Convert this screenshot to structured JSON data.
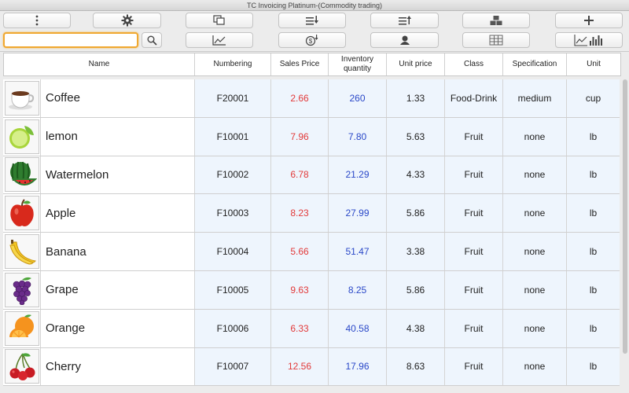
{
  "window": {
    "title": "TC Invoicing Platinum-(Commodity trading)"
  },
  "toolbar": {
    "row1": [
      {
        "name": "more-menu-button",
        "icon": "vertical-dots-icon"
      },
      {
        "name": "settings-button",
        "icon": "gear-icon"
      },
      {
        "name": "copy-button",
        "icon": "copy-pages-icon"
      },
      {
        "name": "import-button",
        "icon": "list-arrow-down-icon"
      },
      {
        "name": "export-button",
        "icon": "list-arrow-up-icon"
      },
      {
        "name": "stock-button",
        "icon": "boxes-stack-icon"
      },
      {
        "name": "add-button",
        "icon": "plus-icon"
      }
    ],
    "row2": [
      {
        "name": "trend-chart-button",
        "icon": "line-chart-icon"
      },
      {
        "name": "pricing-button",
        "icon": "coin-dollar-icon"
      },
      {
        "name": "customer-button",
        "icon": "person-icon"
      },
      {
        "name": "grid-view-button",
        "icon": "table-grid-icon"
      },
      {
        "name": "statistics-button",
        "icon": "chart-bars-icon"
      }
    ],
    "search": {
      "value": "",
      "placeholder": ""
    }
  },
  "table": {
    "columns": [
      "Name",
      "Numbering",
      "Sales Price",
      "Inventory quantity",
      "Unit price",
      "Class",
      "Specification",
      "Unit"
    ],
    "rows": [
      {
        "image": "coffee-cup-icon",
        "name": "Coffee",
        "numbering": "F20001",
        "sales_price": "2.66",
        "inventory": "260",
        "unit_price": "1.33",
        "class": "Food-Drink",
        "spec": "medium",
        "unit": "cup"
      },
      {
        "image": "lemon-icon",
        "name": "lemon",
        "numbering": "F10001",
        "sales_price": "7.96",
        "inventory": "7.80",
        "unit_price": "5.63",
        "class": "Fruit",
        "spec": "none",
        "unit": "lb"
      },
      {
        "image": "watermelon-icon",
        "name": "Watermelon",
        "numbering": "F10002",
        "sales_price": "6.78",
        "inventory": "21.29",
        "unit_price": "4.33",
        "class": "Fruit",
        "spec": "none",
        "unit": "lb"
      },
      {
        "image": "apple-icon",
        "name": "Apple",
        "numbering": "F10003",
        "sales_price": "8.23",
        "inventory": "27.99",
        "unit_price": "5.86",
        "class": "Fruit",
        "spec": "none",
        "unit": "lb"
      },
      {
        "image": "banana-icon",
        "name": "Banana",
        "numbering": "F10004",
        "sales_price": "5.66",
        "inventory": "51.47",
        "unit_price": "3.38",
        "class": "Fruit",
        "spec": "none",
        "unit": "lb"
      },
      {
        "image": "grape-icon",
        "name": "Grape",
        "numbering": "F10005",
        "sales_price": "9.63",
        "inventory": "8.25",
        "unit_price": "5.86",
        "class": "Fruit",
        "spec": "none",
        "unit": "lb"
      },
      {
        "image": "orange-icon",
        "name": "Orange",
        "numbering": "F10006",
        "sales_price": "6.33",
        "inventory": "40.58",
        "unit_price": "4.38",
        "class": "Fruit",
        "spec": "none",
        "unit": "lb"
      },
      {
        "image": "cherry-icon",
        "name": "Cherry",
        "numbering": "F10007",
        "sales_price": "12.56",
        "inventory": "17.96",
        "unit_price": "8.63",
        "class": "Fruit",
        "spec": "none",
        "unit": "lb"
      }
    ]
  },
  "colors": {
    "sales_price": "#e23a3a",
    "inventory": "#2a48c8",
    "data_bg": "#eef5fd",
    "search_focus": "#f0a830"
  }
}
